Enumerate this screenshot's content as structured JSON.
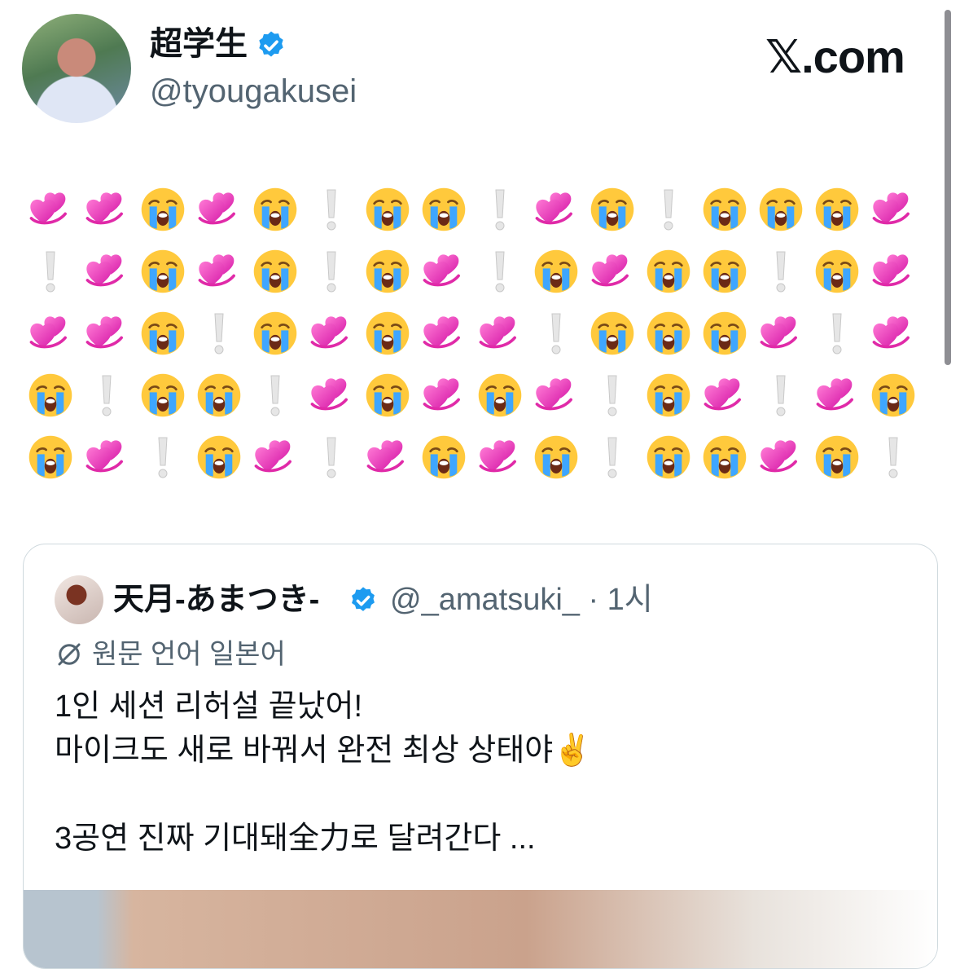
{
  "author": {
    "name": "超学生",
    "handle": "@tyougakusei",
    "verified": true
  },
  "brand": "𝕏.com",
  "emoji_rows": [
    [
      "heart",
      "heart",
      "cry",
      "heart",
      "cry",
      "excl",
      "cry",
      "cry",
      "excl",
      "heart",
      "cry",
      "excl",
      "cry",
      "cry",
      "cry",
      "heart"
    ],
    [
      "excl",
      "heart",
      "cry",
      "heart",
      "cry",
      "excl",
      "cry",
      "heart",
      "excl",
      "cry",
      "heart",
      "cry",
      "cry",
      "excl",
      "cry",
      "heart"
    ],
    [
      "heart",
      "heart",
      "cry",
      "excl",
      "cry",
      "heart",
      "cry",
      "heart",
      "heart",
      "excl",
      "cry",
      "cry",
      "cry",
      "heart",
      "excl",
      "heart"
    ],
    [
      "cry",
      "excl",
      "cry",
      "cry",
      "excl",
      "heart",
      "cry",
      "heart",
      "cry",
      "heart",
      "excl",
      "cry",
      "heart",
      "excl",
      "heart",
      "cry"
    ],
    [
      "cry",
      "heart",
      "excl",
      "cry",
      "heart",
      "excl",
      "heart",
      "cry",
      "heart",
      "cry",
      "excl",
      "cry",
      "cry",
      "heart",
      "cry",
      "excl"
    ]
  ],
  "icons": {
    "heart": "revolving-hearts-emoji",
    "cry": "loudly-crying-face-emoji",
    "excl": "white-exclamation-emoji"
  },
  "quote": {
    "name": "天月-あまつき-",
    "handle_time": "@_amatsuki_ · 1시",
    "translated_label": "원문 언어 일본어",
    "lines": [
      "1인 세션 리허설 끝났어!",
      "마이크도 새로 바꿔서 완전 최상 상태야✌️",
      "",
      "3공연 진짜 기대돼全力로 달려간다  ..."
    ]
  },
  "colors": {
    "verified": "#1d9bf0",
    "text": "#0f1419",
    "secondary": "#536471",
    "border": "#cfd9de"
  }
}
